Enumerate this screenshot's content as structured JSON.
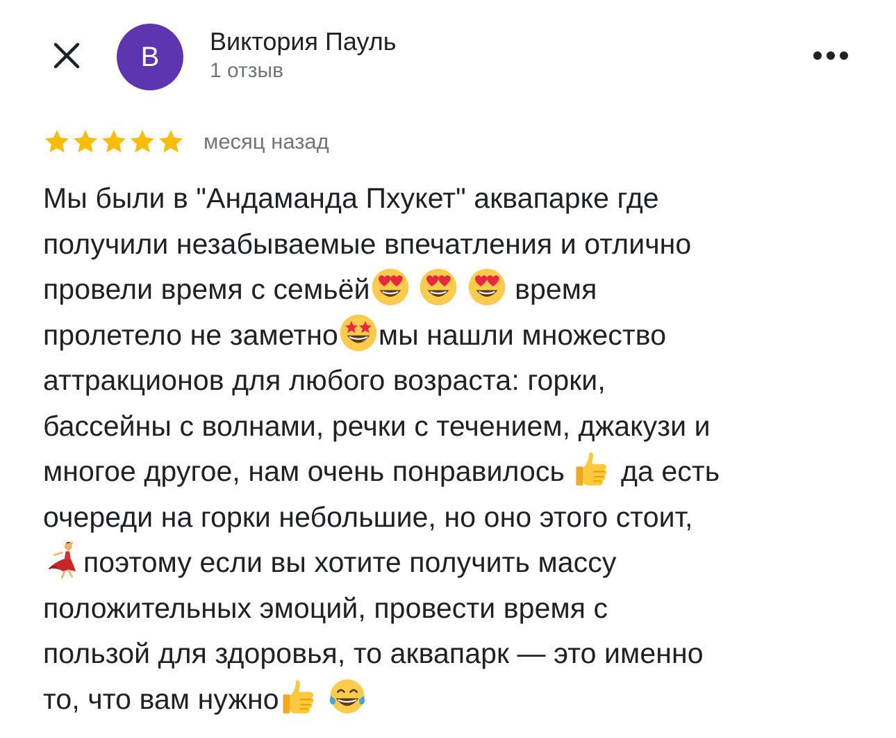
{
  "header": {
    "close_icon": "close-icon",
    "avatar_letter": "В",
    "avatar_color": "#5e35b1",
    "author_name": "Виктория Пауль",
    "author_meta": "1 отзыв",
    "more_icon": "more-horizontal-icon"
  },
  "rating": {
    "stars": 5,
    "max_stars": 5,
    "star_color": "#fbbc04",
    "date": "месяц назад"
  },
  "review": {
    "lines": [
      [
        "Мы были в \"Андаманда Пхукет\" аквапарке где"
      ],
      [
        "получили незабываемые впечатления и отлично"
      ],
      [
        "провели  время с  семьёй",
        {
          "emoji": "heart-eyes-icon"
        },
        " ",
        {
          "emoji": "heart-eyes-icon"
        },
        " ",
        {
          "emoji": "heart-eyes-icon"
        },
        "   время"
      ],
      [
        "пролетело не заметно",
        {
          "emoji": "star-struck-icon"
        },
        "мы нашли множество"
      ],
      [
        "аттракционов для любого возраста: горки,"
      ],
      [
        "бассейны с волнами, речки с течением, джакузи и"
      ],
      [
        "многое другое, нам очень понравилось ",
        {
          "emoji": "thumbs-up-icon"
        },
        " да есть"
      ],
      [
        "очереди на горки небольшие, но оно этого стоит,"
      ],
      [
        {
          "emoji": "dancer-icon"
        },
        "поэтому если вы хотите получить массу"
      ],
      [
        "положительных эмоций, провести время с"
      ],
      [
        "пользой для здоровья, то аквапарк — это именно"
      ],
      [
        "то, что вам нужно",
        {
          "emoji": "thumbs-up-icon"
        },
        " ",
        {
          "emoji": "tears-of-joy-icon"
        }
      ]
    ]
  }
}
